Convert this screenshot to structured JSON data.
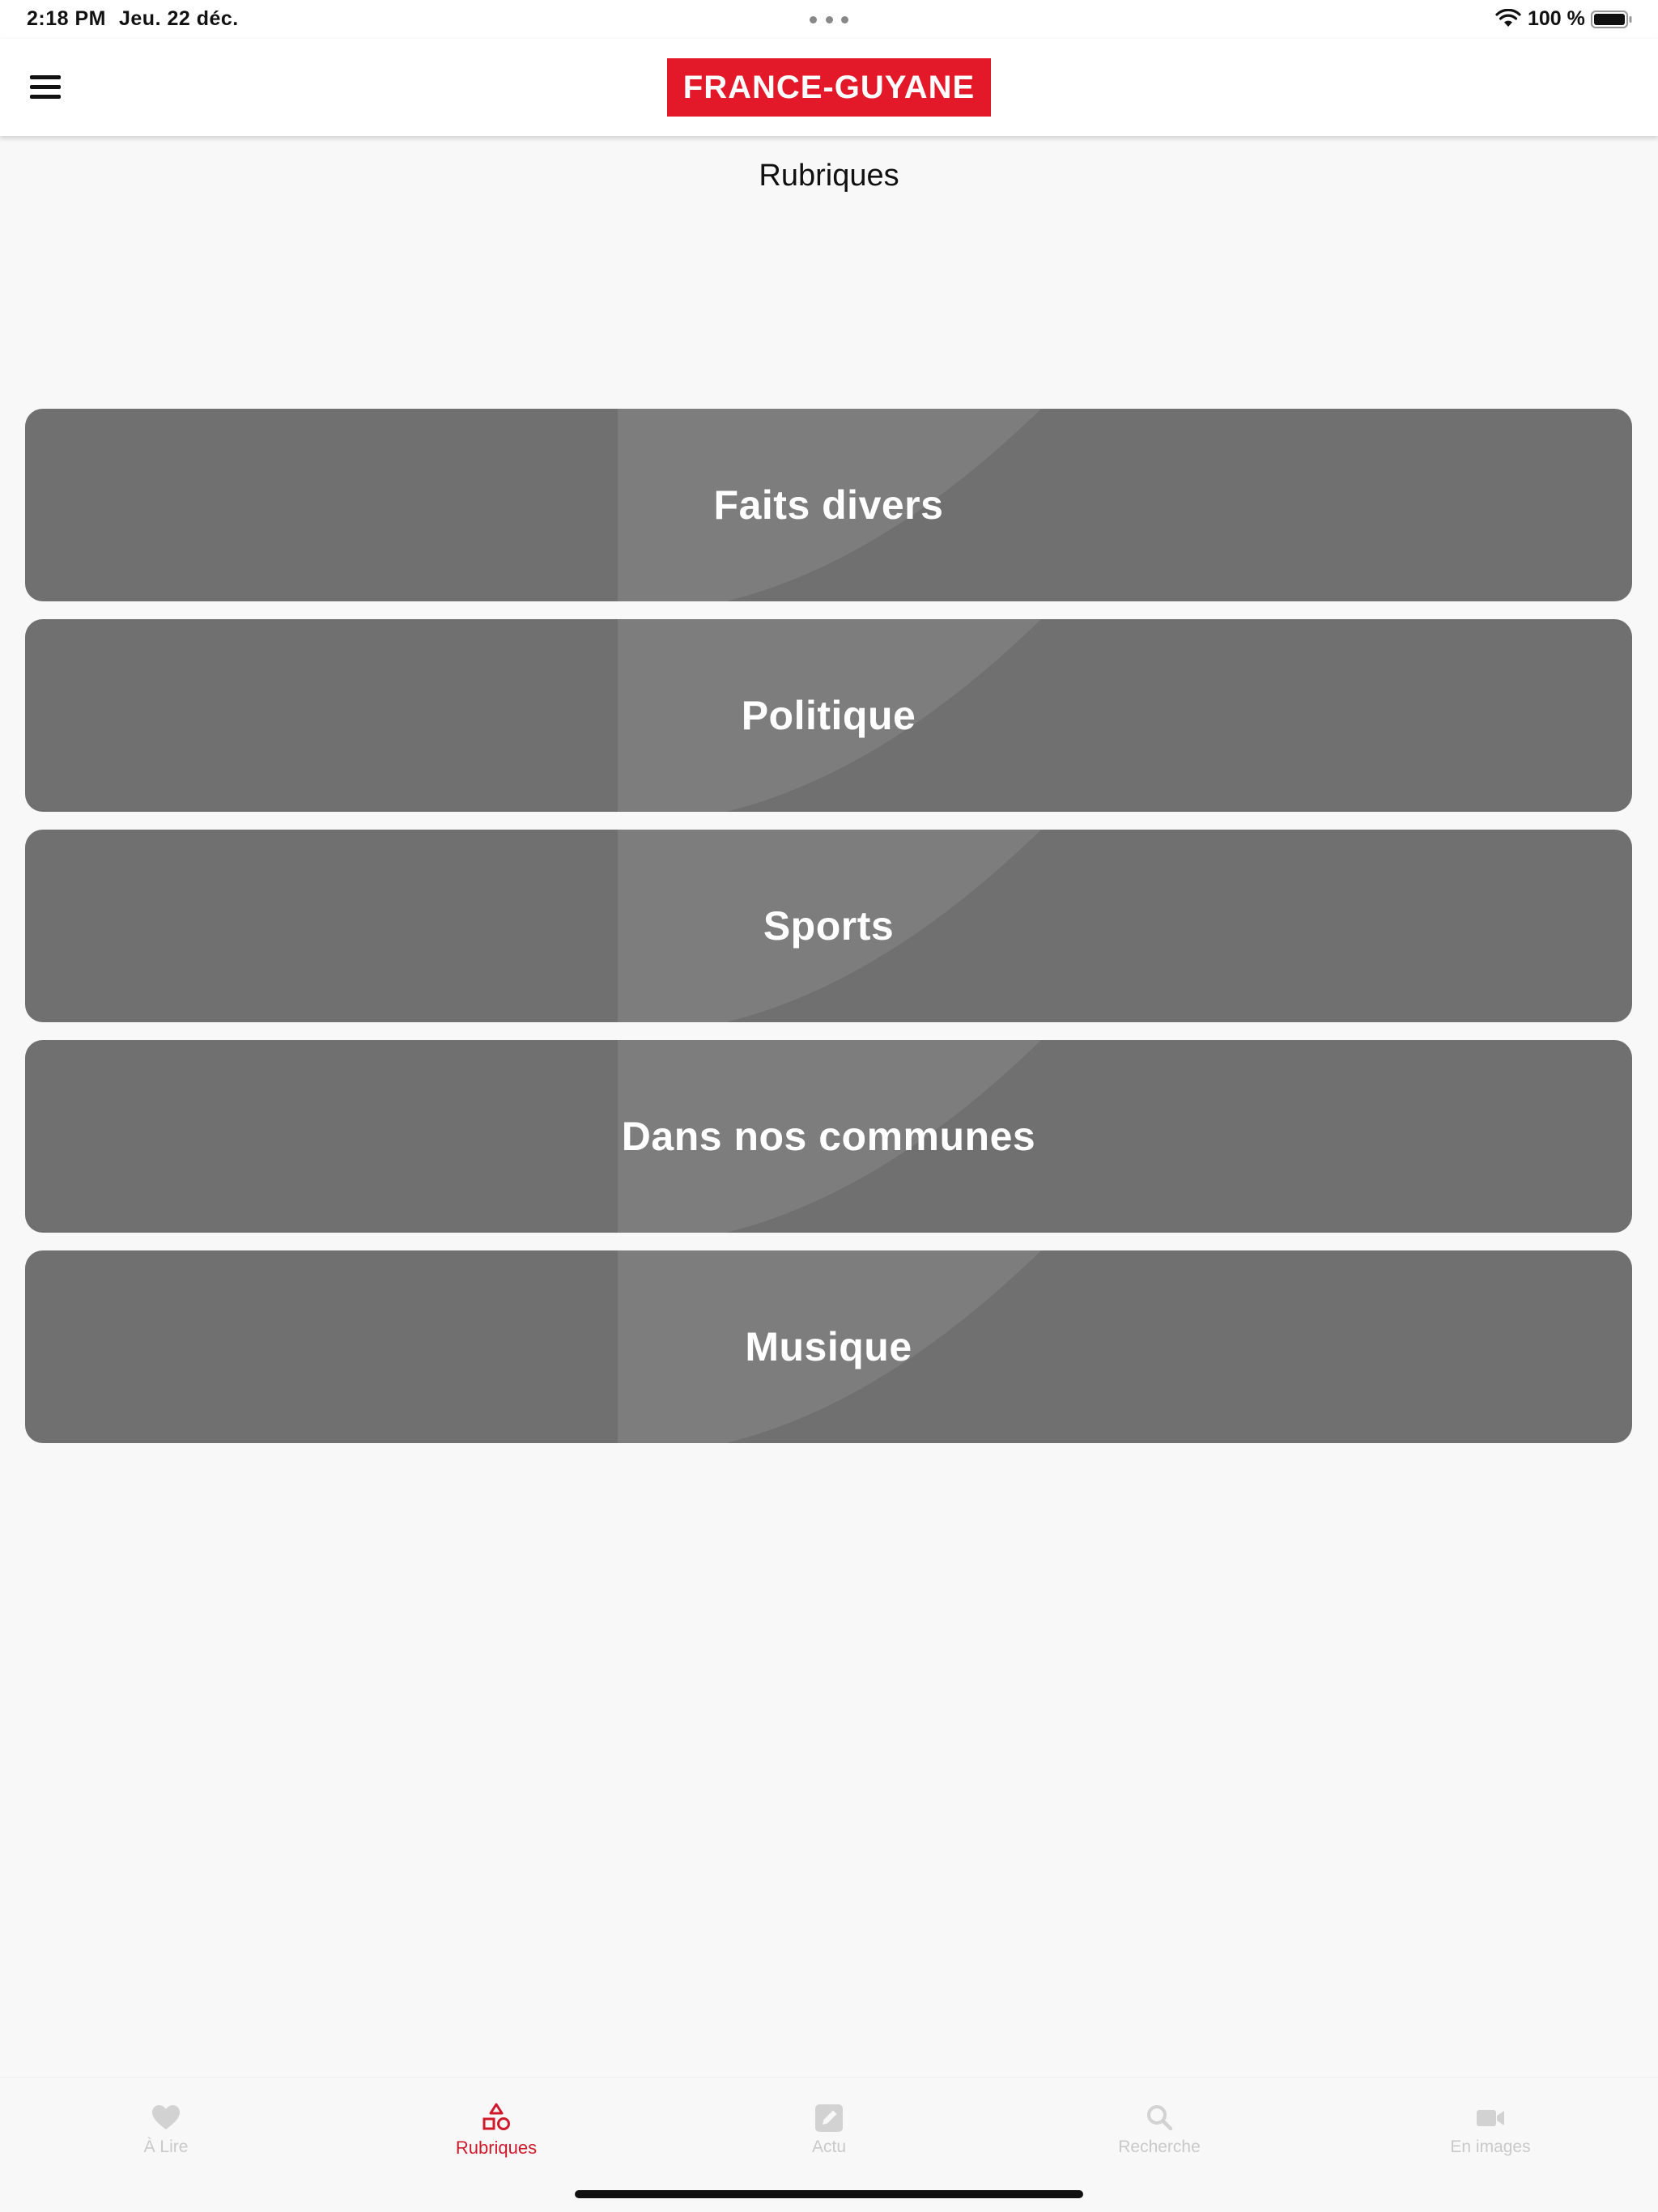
{
  "status_bar": {
    "time": "2:18 PM",
    "date": "Jeu. 22 déc.",
    "battery": "100 %"
  },
  "header": {
    "logo_text": "FRANCE-GUYANE",
    "menu_icon": "hamburger-menu-icon"
  },
  "page": {
    "title": "Rubriques"
  },
  "categories": [
    {
      "label": "Faits divers"
    },
    {
      "label": "Politique"
    },
    {
      "label": "Sports"
    },
    {
      "label": "Dans nos communes"
    },
    {
      "label": "Musique"
    }
  ],
  "tab_bar": {
    "tabs": [
      {
        "label": "À Lire",
        "icon": "heart-icon"
      },
      {
        "label": "Rubriques",
        "icon": "shapes-icon",
        "active": true
      },
      {
        "label": "Actu",
        "icon": "edit-square-icon"
      },
      {
        "label": "Recherche",
        "icon": "search-icon"
      },
      {
        "label": "En images",
        "icon": "video-camera-icon"
      }
    ]
  },
  "colors": {
    "brand_red": "#e3192a",
    "active_tab": "#d0192a",
    "card_bg": "#707070",
    "inactive_tab": "#c9c9c9",
    "page_bg": "#f8f8f8"
  }
}
